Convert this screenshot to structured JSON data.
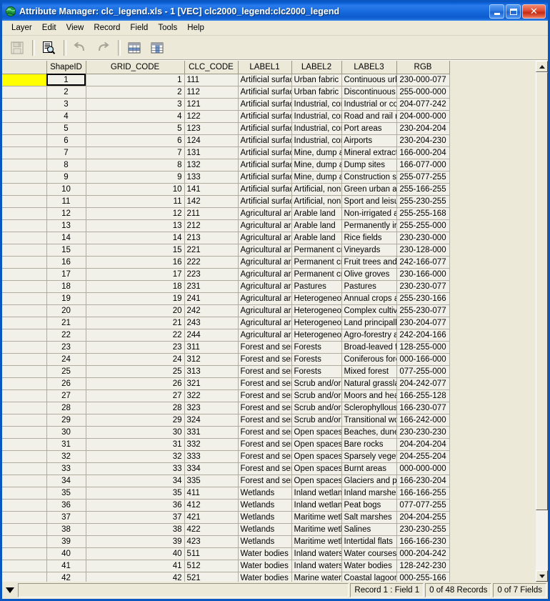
{
  "window": {
    "title": "Attribute Manager: clc_legend.xls - 1 [VEC] clc2000_legend:clc2000_legend",
    "icon": "globe-icon",
    "buttons": {
      "minimize": "minimize-icon",
      "maximize": "maximize-icon",
      "close": "close-icon"
    }
  },
  "menubar": {
    "items": [
      {
        "label": "Layer"
      },
      {
        "label": "Edit"
      },
      {
        "label": "View"
      },
      {
        "label": "Record"
      },
      {
        "label": "Field"
      },
      {
        "label": "Tools"
      },
      {
        "label": "Help"
      }
    ]
  },
  "toolbar": {
    "buttons": [
      {
        "name": "save-button",
        "icon": "floppy-disk-icon",
        "enabled": false
      },
      {
        "name": "print-preview-button",
        "icon": "document-magnifier-icon",
        "enabled": true
      },
      {
        "name": "undo-button",
        "icon": "undo-arrow-icon",
        "enabled": false
      },
      {
        "name": "redo-button",
        "icon": "redo-arrow-icon",
        "enabled": false
      },
      {
        "name": "add-record-button",
        "icon": "table-row-icon",
        "enabled": true
      },
      {
        "name": "add-field-button",
        "icon": "table-column-icon",
        "enabled": true
      }
    ]
  },
  "grid": {
    "columns": [
      {
        "key": "selector",
        "label": ""
      },
      {
        "key": "shapeid",
        "label": "ShapeID",
        "active": true
      },
      {
        "key": "grid_code",
        "label": "GRID_CODE"
      },
      {
        "key": "clc_code",
        "label": "CLC_CODE"
      },
      {
        "key": "label1",
        "label": "LABEL1"
      },
      {
        "key": "label2",
        "label": "LABEL2"
      },
      {
        "key": "label3",
        "label": "LABEL3"
      },
      {
        "key": "rgb",
        "label": "RGB"
      }
    ],
    "current_row": 1,
    "rows": [
      {
        "shapeid": "1",
        "grid_code": "1",
        "clc_code": "111",
        "label1": "Artificial surfaces",
        "label2": "Urban fabric",
        "label3": "Continuous urban fabric",
        "rgb": "230-000-077"
      },
      {
        "shapeid": "2",
        "grid_code": "2",
        "clc_code": "112",
        "label1": "Artificial surfaces",
        "label2": "Urban fabric",
        "label3": "Discontinuous urban fabric",
        "rgb": "255-000-000"
      },
      {
        "shapeid": "3",
        "grid_code": "3",
        "clc_code": "121",
        "label1": "Artificial surfaces",
        "label2": "Industrial, commercial and transport units",
        "label3": "Industrial or commercial units",
        "rgb": "204-077-242"
      },
      {
        "shapeid": "4",
        "grid_code": "4",
        "clc_code": "122",
        "label1": "Artificial surfaces",
        "label2": "Industrial, commercial and transport units",
        "label3": "Road and rail networks and associated land",
        "rgb": "204-000-000"
      },
      {
        "shapeid": "5",
        "grid_code": "5",
        "clc_code": "123",
        "label1": "Artificial surfaces",
        "label2": "Industrial, commercial and transport units",
        "label3": "Port areas",
        "rgb": "230-204-204"
      },
      {
        "shapeid": "6",
        "grid_code": "6",
        "clc_code": "124",
        "label1": "Artificial surfaces",
        "label2": "Industrial, commercial and transport units",
        "label3": "Airports",
        "rgb": "230-204-230"
      },
      {
        "shapeid": "7",
        "grid_code": "7",
        "clc_code": "131",
        "label1": "Artificial surfaces",
        "label2": "Mine, dump and construction sites",
        "label3": "Mineral extraction sites",
        "rgb": "166-000-204"
      },
      {
        "shapeid": "8",
        "grid_code": "8",
        "clc_code": "132",
        "label1": "Artificial surfaces",
        "label2": "Mine, dump and construction sites",
        "label3": "Dump sites",
        "rgb": "166-077-000"
      },
      {
        "shapeid": "9",
        "grid_code": "9",
        "clc_code": "133",
        "label1": "Artificial surfaces",
        "label2": "Mine, dump and construction sites",
        "label3": "Construction sites",
        "rgb": "255-077-255"
      },
      {
        "shapeid": "10",
        "grid_code": "10",
        "clc_code": "141",
        "label1": "Artificial surfaces",
        "label2": "Artificial, non-agricultural vegetated areas",
        "label3": "Green urban areas",
        "rgb": "255-166-255"
      },
      {
        "shapeid": "11",
        "grid_code": "11",
        "clc_code": "142",
        "label1": "Artificial surfaces",
        "label2": "Artificial, non-agricultural vegetated areas",
        "label3": "Sport and leisure facilities",
        "rgb": "255-230-255"
      },
      {
        "shapeid": "12",
        "grid_code": "12",
        "clc_code": "211",
        "label1": "Agricultural areas",
        "label2": "Arable land",
        "label3": "Non-irrigated arable land",
        "rgb": "255-255-168"
      },
      {
        "shapeid": "13",
        "grid_code": "13",
        "clc_code": "212",
        "label1": "Agricultural areas",
        "label2": "Arable land",
        "label3": "Permanently irrigated land",
        "rgb": "255-255-000"
      },
      {
        "shapeid": "14",
        "grid_code": "14",
        "clc_code": "213",
        "label1": "Agricultural areas",
        "label2": "Arable land",
        "label3": "Rice fields",
        "rgb": "230-230-000"
      },
      {
        "shapeid": "15",
        "grid_code": "15",
        "clc_code": "221",
        "label1": "Agricultural areas",
        "label2": "Permanent crops",
        "label3": "Vineyards",
        "rgb": "230-128-000"
      },
      {
        "shapeid": "16",
        "grid_code": "16",
        "clc_code": "222",
        "label1": "Agricultural areas",
        "label2": "Permanent crops",
        "label3": "Fruit trees and berry plantations",
        "rgb": "242-166-077"
      },
      {
        "shapeid": "17",
        "grid_code": "17",
        "clc_code": "223",
        "label1": "Agricultural areas",
        "label2": "Permanent crops",
        "label3": "Olive groves",
        "rgb": "230-166-000"
      },
      {
        "shapeid": "18",
        "grid_code": "18",
        "clc_code": "231",
        "label1": "Agricultural areas",
        "label2": "Pastures",
        "label3": "Pastures",
        "rgb": "230-230-077"
      },
      {
        "shapeid": "19",
        "grid_code": "19",
        "clc_code": "241",
        "label1": "Agricultural areas",
        "label2": "Heterogeneous agricultural areas",
        "label3": "Annual crops associated with permanent crops",
        "rgb": "255-230-166"
      },
      {
        "shapeid": "20",
        "grid_code": "20",
        "clc_code": "242",
        "label1": "Agricultural areas",
        "label2": "Heterogeneous agricultural areas",
        "label3": "Complex cultivation patterns",
        "rgb": "255-230-077"
      },
      {
        "shapeid": "21",
        "grid_code": "21",
        "clc_code": "243",
        "label1": "Agricultural areas",
        "label2": "Heterogeneous agricultural areas",
        "label3": "Land principally occupied by agriculture",
        "rgb": "230-204-077"
      },
      {
        "shapeid": "22",
        "grid_code": "22",
        "clc_code": "244",
        "label1": "Agricultural areas",
        "label2": "Heterogeneous agricultural areas",
        "label3": "Agro-forestry areas",
        "rgb": "242-204-166"
      },
      {
        "shapeid": "23",
        "grid_code": "23",
        "clc_code": "311",
        "label1": "Forest and semi natural areas",
        "label2": "Forests",
        "label3": "Broad-leaved forest",
        "rgb": "128-255-000"
      },
      {
        "shapeid": "24",
        "grid_code": "24",
        "clc_code": "312",
        "label1": "Forest and semi natural areas",
        "label2": "Forests",
        "label3": "Coniferous forest",
        "rgb": "000-166-000"
      },
      {
        "shapeid": "25",
        "grid_code": "25",
        "clc_code": "313",
        "label1": "Forest and semi natural areas",
        "label2": "Forests",
        "label3": "Mixed forest",
        "rgb": "077-255-000"
      },
      {
        "shapeid": "26",
        "grid_code": "26",
        "clc_code": "321",
        "label1": "Forest and semi natural areas",
        "label2": "Scrub and/or herbaceous vegetation associations",
        "label3": "Natural grassland",
        "rgb": "204-242-077"
      },
      {
        "shapeid": "27",
        "grid_code": "27",
        "clc_code": "322",
        "label1": "Forest and semi natural areas",
        "label2": "Scrub and/or herbaceous vegetation associations",
        "label3": "Moors and heathland",
        "rgb": "166-255-128"
      },
      {
        "shapeid": "28",
        "grid_code": "28",
        "clc_code": "323",
        "label1": "Forest and semi natural areas",
        "label2": "Scrub and/or herbaceous vegetation associations",
        "label3": "Sclerophyllous vegetation",
        "rgb": "166-230-077"
      },
      {
        "shapeid": "29",
        "grid_code": "29",
        "clc_code": "324",
        "label1": "Forest and semi natural areas",
        "label2": "Scrub and/or herbaceous vegetation associations",
        "label3": "Transitional woodland-shrub",
        "rgb": "166-242-000"
      },
      {
        "shapeid": "30",
        "grid_code": "30",
        "clc_code": "331",
        "label1": "Forest and semi natural areas",
        "label2": "Open spaces with little or no vegetation",
        "label3": "Beaches, dunes, sands",
        "rgb": "230-230-230"
      },
      {
        "shapeid": "31",
        "grid_code": "31",
        "clc_code": "332",
        "label1": "Forest and semi natural areas",
        "label2": "Open spaces with little or no vegetation",
        "label3": "Bare rocks",
        "rgb": "204-204-204"
      },
      {
        "shapeid": "32",
        "grid_code": "32",
        "clc_code": "333",
        "label1": "Forest and semi natural areas",
        "label2": "Open spaces with little or no vegetation",
        "label3": "Sparsely vegetated areas",
        "rgb": "204-255-204"
      },
      {
        "shapeid": "33",
        "grid_code": "33",
        "clc_code": "334",
        "label1": "Forest and semi natural areas",
        "label2": "Open spaces with little or no vegetation",
        "label3": "Burnt areas",
        "rgb": "000-000-000"
      },
      {
        "shapeid": "34",
        "grid_code": "34",
        "clc_code": "335",
        "label1": "Forest and semi natural areas",
        "label2": "Open spaces with little or no vegetation",
        "label3": "Glaciers and perpetual snow",
        "rgb": "166-230-204"
      },
      {
        "shapeid": "35",
        "grid_code": "35",
        "clc_code": "411",
        "label1": "Wetlands",
        "label2": "Inland wetlands",
        "label3": "Inland marshes",
        "rgb": "166-166-255"
      },
      {
        "shapeid": "36",
        "grid_code": "36",
        "clc_code": "412",
        "label1": "Wetlands",
        "label2": "Inland wetlands",
        "label3": "Peat bogs",
        "rgb": "077-077-255"
      },
      {
        "shapeid": "37",
        "grid_code": "37",
        "clc_code": "421",
        "label1": "Wetlands",
        "label2": "Maritime wetlands",
        "label3": "Salt marshes",
        "rgb": "204-204-255"
      },
      {
        "shapeid": "38",
        "grid_code": "38",
        "clc_code": "422",
        "label1": "Wetlands",
        "label2": "Maritime wetlands",
        "label3": "Salines",
        "rgb": "230-230-255"
      },
      {
        "shapeid": "39",
        "grid_code": "39",
        "clc_code": "423",
        "label1": "Wetlands",
        "label2": "Maritime wetlands",
        "label3": "Intertidal flats",
        "rgb": "166-166-230"
      },
      {
        "shapeid": "40",
        "grid_code": "40",
        "clc_code": "511",
        "label1": "Water bodies",
        "label2": "Inland waters",
        "label3": "Water courses",
        "rgb": "000-204-242"
      },
      {
        "shapeid": "41",
        "grid_code": "41",
        "clc_code": "512",
        "label1": "Water bodies",
        "label2": "Inland waters",
        "label3": "Water bodies",
        "rgb": "128-242-230"
      },
      {
        "shapeid": "42",
        "grid_code": "42",
        "clc_code": "521",
        "label1": "Water bodies",
        "label2": "Marine waters",
        "label3": "Coastal lagoons",
        "rgb": "000-255-166"
      }
    ]
  },
  "statusbar": {
    "dropdown": "dropdown-arrow-icon",
    "message": "",
    "record_field": "Record 1 : Field 1",
    "records": "0 of 48 Records",
    "fields": "0 of 7 Fields"
  },
  "colors": {
    "titlebar_blue": "#0c59cf",
    "window_face": "#ece9d8",
    "active_header_red": "#e81b1b",
    "current_row_yellow": "#ffff00",
    "grid_cell": "#f1f0e9",
    "selector_cell": "#e8e5d0"
  }
}
